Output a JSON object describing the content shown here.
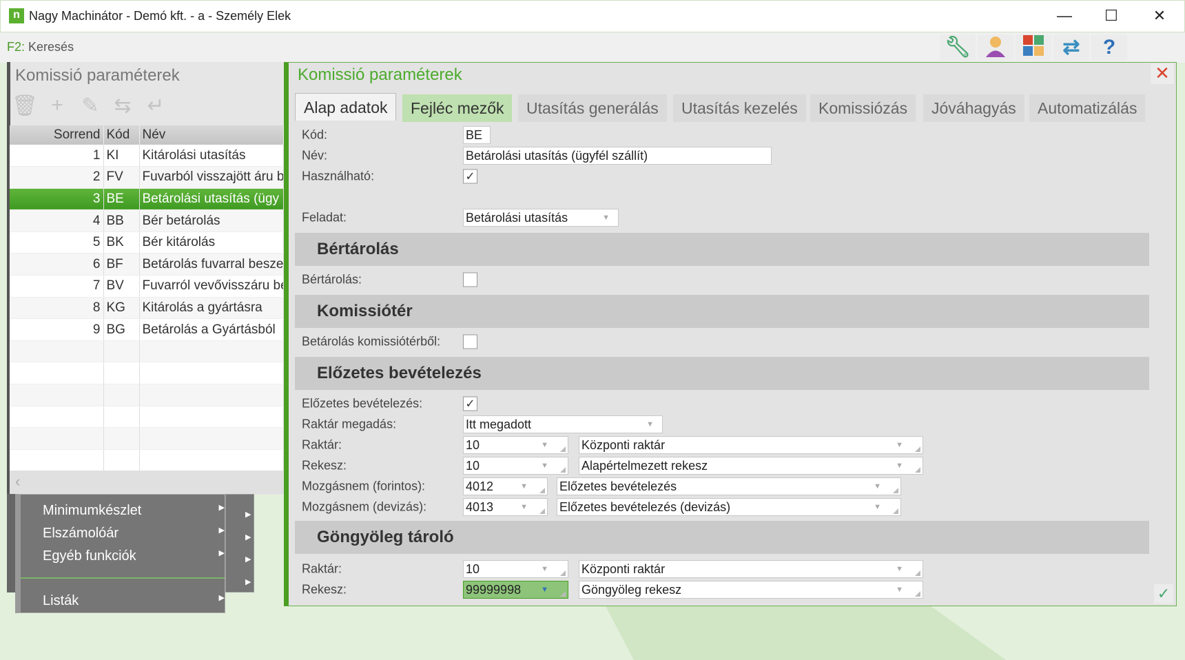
{
  "window": {
    "title": "Nagy Machinátor - Demó kft. - a - Személy Elek",
    "logo": "n",
    "minimize": "—",
    "maximize": "☐",
    "close": "✕"
  },
  "toolbar": {
    "search_key": "F2:",
    "search_label": "Keresés",
    "icons": [
      "wrench-icon",
      "user-icon",
      "apps-icon",
      "swap-icon",
      "help-icon"
    ]
  },
  "left_panel": {
    "title": "Komissió paraméterek",
    "columns": [
      "Sorrend",
      "Kód",
      "Név"
    ],
    "rows": [
      {
        "order": "1",
        "code": "KI",
        "name": "Kitárolási utasítás"
      },
      {
        "order": "2",
        "code": "FV",
        "name": "Fuvarból visszajött áru b"
      },
      {
        "order": "3",
        "code": "BE",
        "name": "Betárolási utasítás (ügy"
      },
      {
        "order": "4",
        "code": "BB",
        "name": "Bér betárolás"
      },
      {
        "order": "5",
        "code": "BK",
        "name": "Bér kitárolás"
      },
      {
        "order": "6",
        "code": "BF",
        "name": "Betárolás fuvarral besze"
      },
      {
        "order": "7",
        "code": "BV",
        "name": "Fuvarról vevővisszáru be"
      },
      {
        "order": "8",
        "code": "KG",
        "name": "Kitárolás a gyártásra"
      },
      {
        "order": "9",
        "code": "BG",
        "name": "Betárolás a Gyártásból"
      }
    ],
    "selected_index": 2
  },
  "menu": {
    "items": [
      "Minimumkészlet",
      "Elszámolóár",
      "Egyéb funkciók",
      "Listák"
    ]
  },
  "panel": {
    "title": "Komissió paraméterek",
    "tabs": [
      "Alap adatok",
      "Fejléc mezők",
      "Utasítás generálás",
      "Utasítás kezelés",
      "Komissiózás",
      "Jóváhagyás",
      "Automatizálás"
    ],
    "kod_label": "Kód:",
    "kod": "BE",
    "nev_label": "Név:",
    "nev": "Betárolási utasítás (ügyfél szállít)",
    "hasznalhato_label": "Használható:",
    "hasznalhato": true,
    "feladat_label": "Feladat:",
    "feladat": "Betárolási utasítás",
    "sec_bertarolas": "Bértárolás",
    "bertarolas_label": "Bértárolás:",
    "bertarolas": false,
    "sec_komissioter": "Komissiótér",
    "betar_kom_label": "Betárolás komissiótérből:",
    "betar_kom": false,
    "sec_elozetes": "Előzetes bevételezés",
    "elozetes_label": "Előzetes bevételezés:",
    "elozetes": true,
    "raktar_megadas_label": "Raktár megadás:",
    "raktar_megadas": "Itt megadott",
    "raktar_label": "Raktár:",
    "raktar_code": "10",
    "raktar_name": "Központi raktár",
    "rekesz_label": "Rekesz:",
    "rekesz_code": "10",
    "rekesz_name": "Alapértelmezett rekesz",
    "mozg_ft_label": "Mozgásnem (forintos):",
    "mozg_ft_code": "4012",
    "mozg_ft_name": "Előzetes bevételezés",
    "mozg_dev_label": "Mozgásnem (devizás):",
    "mozg_dev_code": "4013",
    "mozg_dev_name": "Előzetes bevételezés (devizás)",
    "sec_gongyoleg": "Göngyöleg tároló",
    "g_raktar_label": "Raktár:",
    "g_raktar_code": "10",
    "g_raktar_name": "Központi raktár",
    "g_rekesz_label": "Rekesz:",
    "g_rekesz_code": "99999998",
    "g_rekesz_name": "Göngyöleg rekesz",
    "close": "✕",
    "ok": "✓",
    "check": "✓"
  }
}
